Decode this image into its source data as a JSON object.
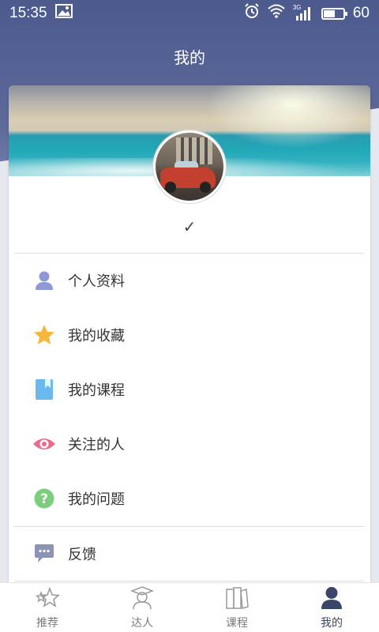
{
  "status_bar": {
    "time": "15:35",
    "network": "3G",
    "battery": "60"
  },
  "header": {
    "title": "我的"
  },
  "profile": {
    "status_mark": "✓"
  },
  "menu": [
    {
      "label": "个人资料",
      "icon": "person-icon",
      "color": "#8f98d8"
    },
    {
      "label": "我的收藏",
      "icon": "star-icon",
      "color": "#f6b73c"
    },
    {
      "label": "我的课程",
      "icon": "bookmark-book-icon",
      "color": "#6ab8ec"
    },
    {
      "label": "关注的人",
      "icon": "eye-icon",
      "color": "#ec6a8a"
    },
    {
      "label": "我的问题",
      "icon": "question-icon",
      "color": "#7ccf7a"
    },
    {
      "label": "反馈",
      "icon": "chat-bubble-icon",
      "color": "#8b93b7"
    }
  ],
  "tabs": [
    {
      "label": "推荐",
      "icon": "stars-icon",
      "active": false
    },
    {
      "label": "达人",
      "icon": "expert-icon",
      "active": false
    },
    {
      "label": "课程",
      "icon": "books-icon",
      "active": false
    },
    {
      "label": "我的",
      "icon": "user-icon",
      "active": true
    }
  ],
  "colors": {
    "header_gradient_top": "#4d5a8e",
    "active_tab": "#3a4667"
  }
}
